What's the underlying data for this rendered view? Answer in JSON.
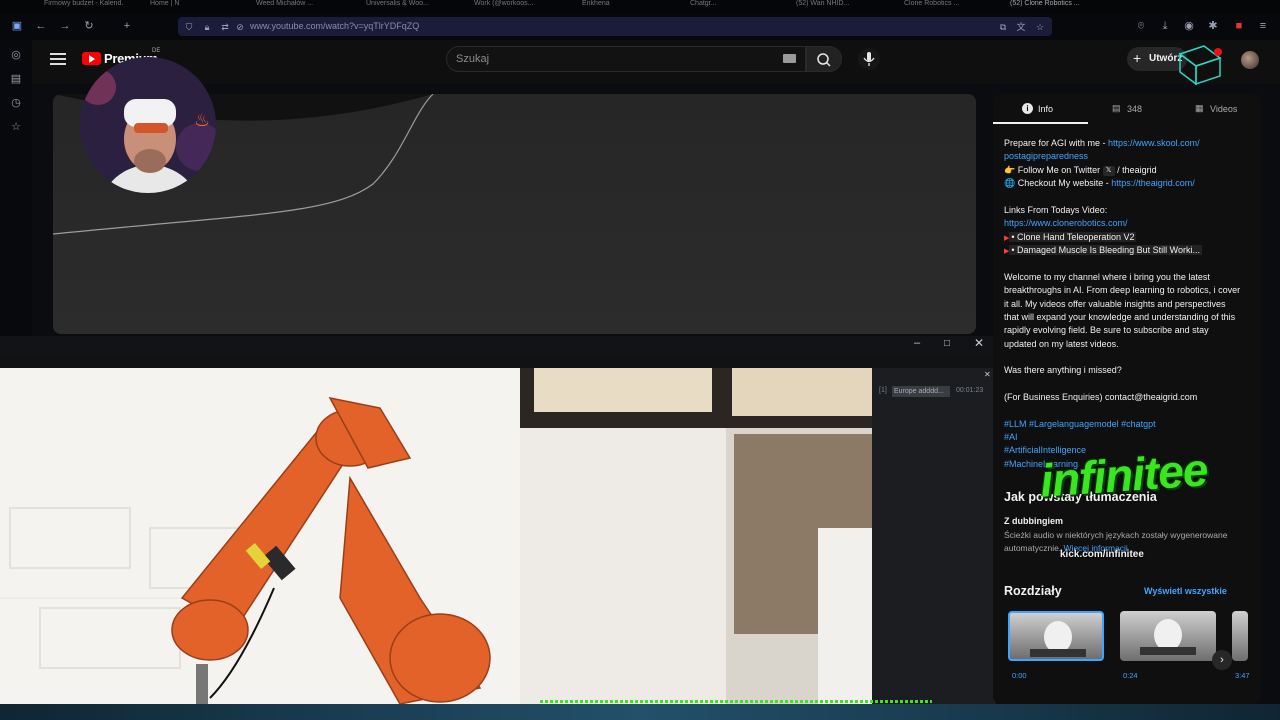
{
  "browser": {
    "tabs": [
      "Firmowy budżet - Kalend...",
      "Home | N",
      "Weed Michałów ...",
      "Universalis & Woo...",
      "Work (@workoos...",
      "Enkhena",
      "Chatgr...",
      "(52) Wan NHID...",
      "Clone Robotics ...",
      "(52) Clone Robotics ..."
    ],
    "url": "www.youtube.com/watch?v=yqTlrYDFqZQ",
    "icons": [
      "back-icon",
      "forward-icon",
      "reload-icon",
      "new-tab-icon",
      "shield-icon",
      "lock-icon",
      "camera-icon",
      "download-icon",
      "extensions-icon"
    ]
  },
  "youtube": {
    "logo_text": "Premium",
    "region": "DE",
    "search_placeholder": "Szukaj",
    "create_label": "Utwórz"
  },
  "popup": {
    "console_entry_index": "[1]",
    "console_entry_label": "Europe adddd...",
    "console_entry_time": "00:01:23"
  },
  "panel": {
    "tabs": {
      "info": "Info",
      "comments": "348",
      "videos": "Videos"
    },
    "description": {
      "line1_prefix": "Prepare for AGI with me - ",
      "line1_link": "https://www.skool.com/",
      "line2_link": "postagipreparedness",
      "line3_prefix": "👉 Follow Me on Twitter ",
      "line3_handle": " / theaigrid",
      "line4_prefix": "🌐 Checkout My website - ",
      "line4_link": "https://theaigrid.com/",
      "links_heading": "Links From Todays Video:",
      "clone_link": "https://www.clonerobotics.com/",
      "video1": "• Clone Hand Teleoperation V2",
      "video2": "• Damaged Muscle Is Bleeding But Still Worki...",
      "welcome_lines": [
        "Welcome to my channel where i bring you the latest",
        "breakthroughs in AI. From deep learning to robotics, i cover",
        "it all. My videos offer valuable insights and perspectives",
        "that will expand your knowledge and understanding of this",
        "rapidly evolving field. Be sure to subscribe and stay",
        "updated on my latest videos."
      ],
      "missed": "Was there anything i missed?",
      "business_prefix": "(For Business Enquiries)  ",
      "business_email": "contact@theaigrid.com",
      "hashtags": [
        "#LLM #Largelanguagemodel #chatgpt",
        "#AI",
        "#ArtificialIntelligence",
        "#MachineLearning"
      ]
    },
    "dubbing": {
      "heading": "Jak powstały tłumaczenia",
      "subheading": "Z dubbingiem",
      "body": "Ścieżki audio w niektórych językach zostały wygenerowane",
      "body2": "automatycznie.",
      "more": "Więcej informacji"
    },
    "chapters": {
      "heading": "Rozdziały",
      "show_all": "Wyświetl wszystkie",
      "times": [
        "0:00",
        "0:24",
        "3:47"
      ]
    }
  },
  "overlay": {
    "brand": "infinitee",
    "kick": "kick.com/infinitee"
  },
  "colors": {
    "link": "#3ea6ff",
    "youtube_red": "#ff0000",
    "overlay_green": "#39e61f",
    "robot_orange": "#e2622a"
  }
}
